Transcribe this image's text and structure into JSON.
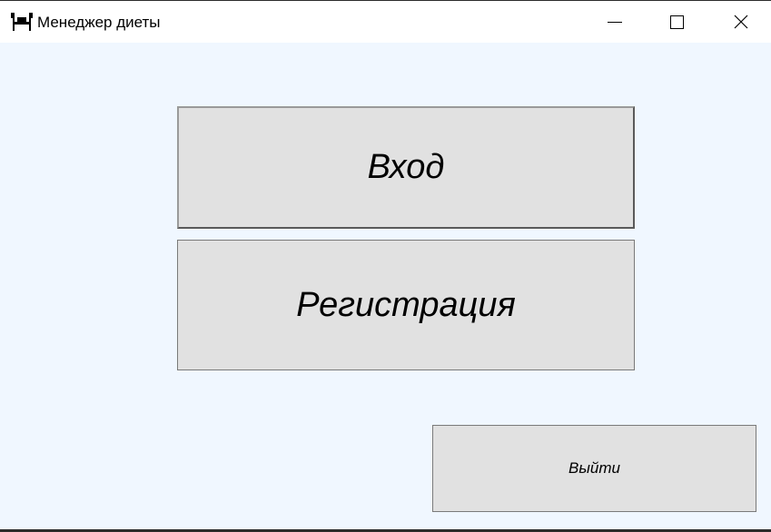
{
  "window": {
    "title": "Менеджер диеты",
    "app_icon": "dining-table-icon",
    "controls": {
      "minimize_icon": "minimize-icon",
      "maximize_icon": "maximize-icon",
      "close_icon": "close-icon"
    }
  },
  "main": {
    "login_label": "Вход",
    "register_label": "Регистрация",
    "exit_label": "Выйти"
  },
  "colors": {
    "client_background": "#f0f7ff",
    "button_background": "#e1e1e1",
    "button_border": "#7a7a7a",
    "titlebar_background": "#ffffff"
  }
}
